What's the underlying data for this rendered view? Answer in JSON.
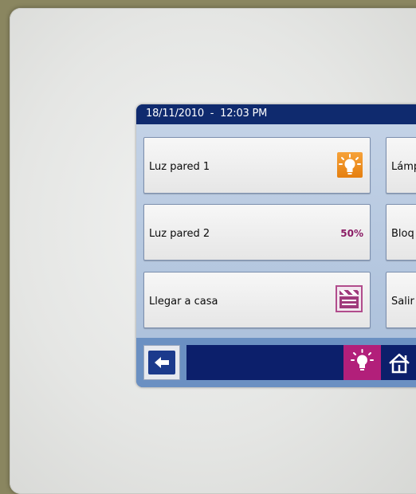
{
  "header": {
    "datetime": "18/11/2010  -  12:03 PM"
  },
  "tiles": [
    {
      "label": "Luz pared 1",
      "icon": "lightbulb-icon",
      "icon_color": "#F0901F"
    },
    {
      "label": "Lámp"
    },
    {
      "label": "Luz pared 2",
      "value": "50%",
      "value_color": "#8B1C65"
    },
    {
      "label": "Bloq"
    },
    {
      "label": "Llegar a casa",
      "icon": "clapperboard-icon",
      "icon_color": "#B14C8C"
    },
    {
      "label": "Salir"
    }
  ],
  "bottom_nav": {
    "back_icon": "arrow-left-icon",
    "lights_icon": "lightbulb-icon",
    "lights_color": "#B21F7A",
    "home_icon": "home-icon"
  }
}
